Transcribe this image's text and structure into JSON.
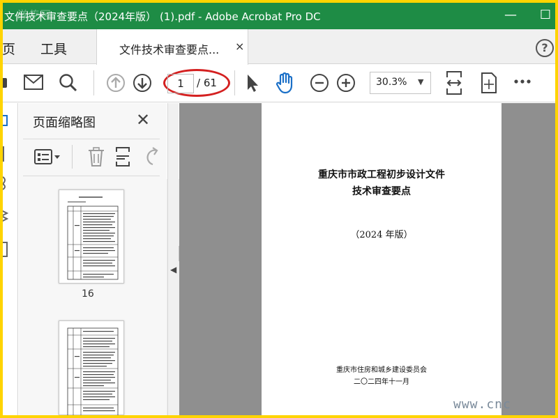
{
  "window": {
    "title": "文件技术审查要点（2024年版） (1).pdf - Adobe Acrobat Pro DC",
    "minimize": "—",
    "maximize": "☐",
    "watermark_text": "游传网"
  },
  "nav": {
    "home": "主页",
    "tools": "工具"
  },
  "tab": {
    "label": "文件技术审查要点...",
    "close": "×"
  },
  "help_label": "?",
  "toolbar": {
    "current_page": "1",
    "total_pages": "/ 61",
    "zoom": "30.3%",
    "highlight_color": "#d42020"
  },
  "panel": {
    "title": "页面缩略图",
    "close": "✕",
    "thumbnails": [
      {
        "label": "16"
      }
    ]
  },
  "document": {
    "title_line1": "重庆市市政工程初步设计文件",
    "title_line2": "技术审查要点",
    "edition": "（2024 年版）",
    "organization": "重庆市住房和城乡建设委员会",
    "date": "二〇二四年十一月"
  },
  "site_watermark": "www.cnc",
  "colors": {
    "titlebar": "#1e8c45",
    "border": "#ffd400",
    "doc_background": "#8f8f8f"
  }
}
